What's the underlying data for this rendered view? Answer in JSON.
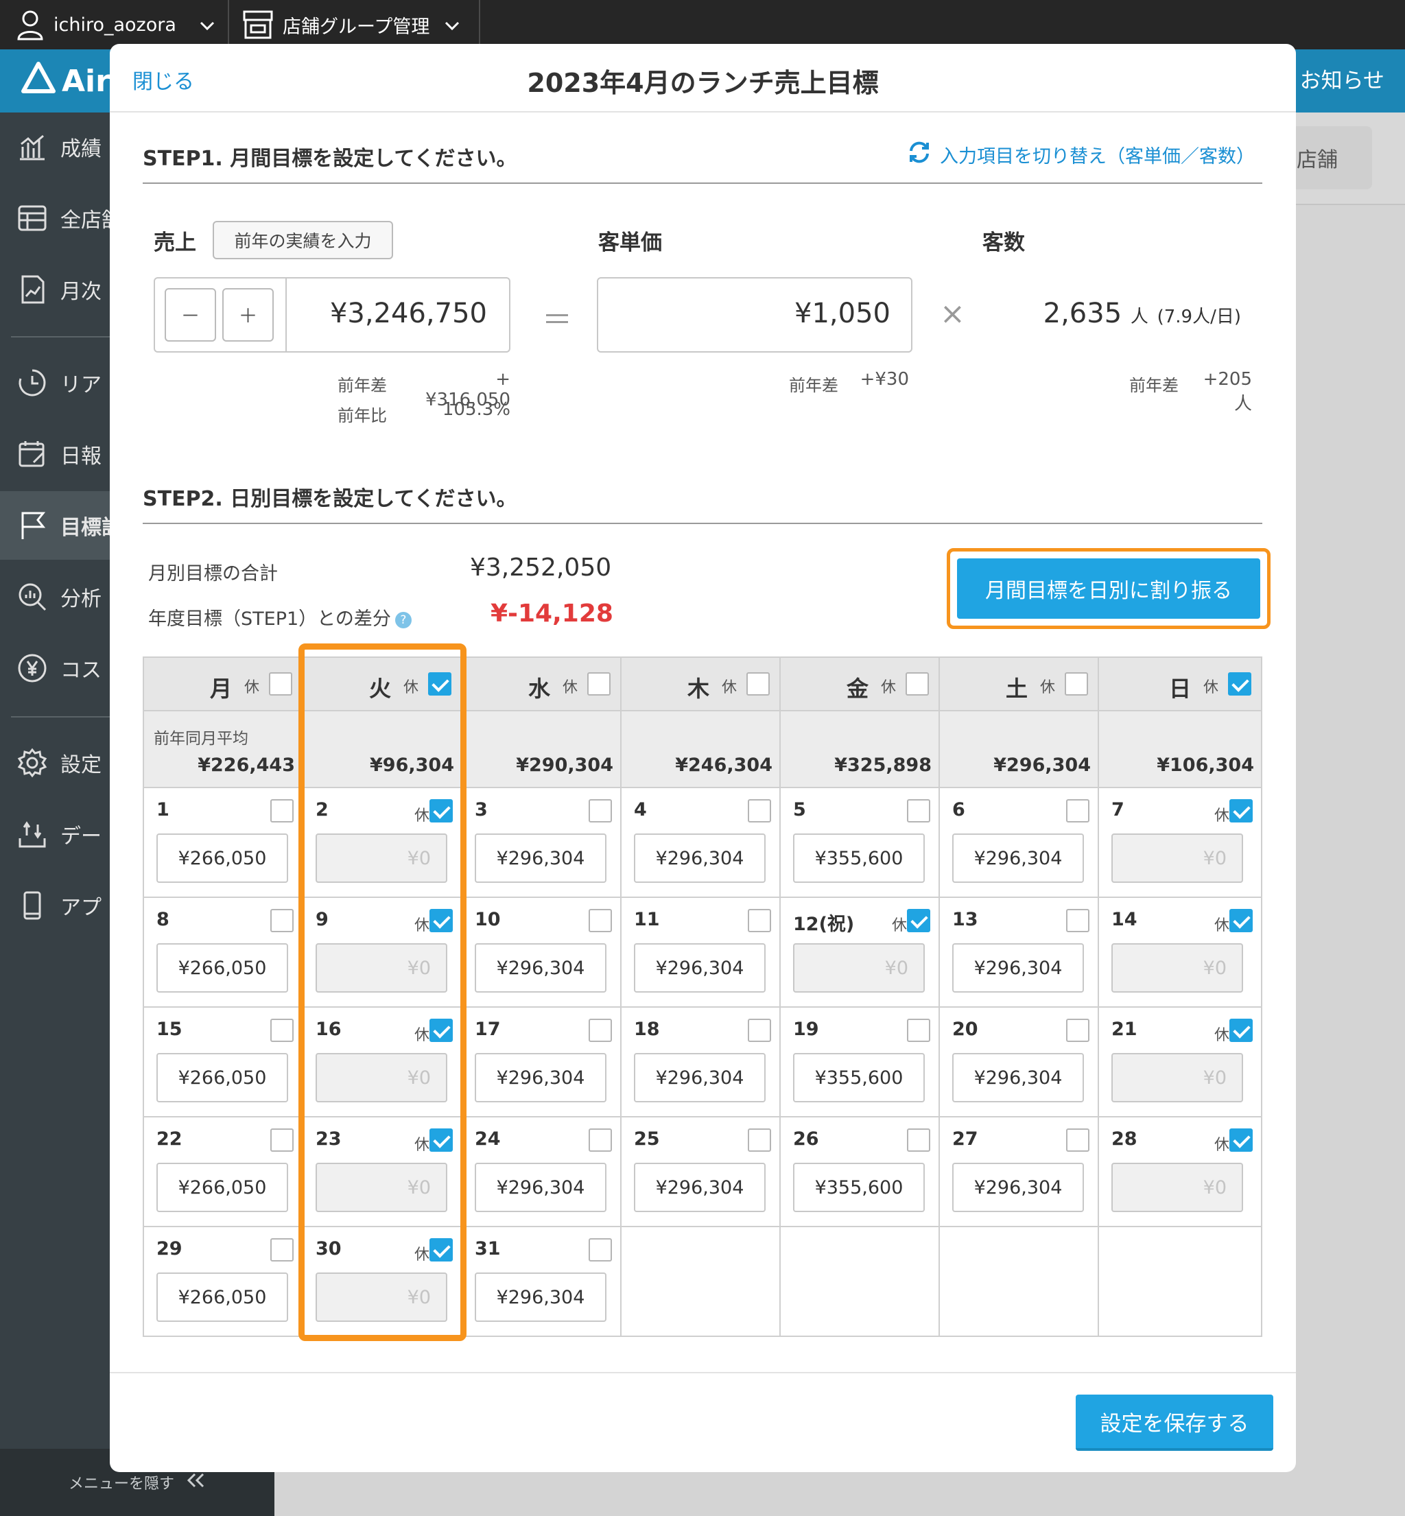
{
  "topbar": {
    "user": "ichiro_aozora",
    "store_menu": "店舗グループ管理",
    "notice": "お知らせ"
  },
  "brand": {
    "name": "Air"
  },
  "sidebar": {
    "items": [
      {
        "label": "成績",
        "icon": "bar-chart-icon"
      },
      {
        "label": "全店舗",
        "icon": "table-icon"
      },
      {
        "label": "月次",
        "icon": "report-icon"
      },
      {
        "label": "リア",
        "icon": "clock-icon"
      },
      {
        "label": "日報",
        "icon": "calendar-edit-icon"
      },
      {
        "label": "目標設",
        "icon": "flag-icon",
        "active": true
      },
      {
        "label": "分析",
        "icon": "analysis-icon"
      },
      {
        "label": "コス",
        "icon": "yen-icon"
      },
      {
        "label": "設定",
        "icon": "gear-icon"
      },
      {
        "label": "デー",
        "icon": "data-icon"
      },
      {
        "label": "アプ",
        "icon": "phone-icon"
      }
    ],
    "hide_menu": "メニューを隠す"
  },
  "background": {
    "tab": "店舗"
  },
  "modal": {
    "close": "閉じる",
    "title": "2023年4月のランチ売上目標",
    "step1": {
      "title": "STEP1. 月間目標を設定してください。",
      "switch_label": "入力項目を切り替え（客単価／客数）",
      "sales_label": "売上",
      "prev_button": "前年の実績を入力",
      "minus": "－",
      "plus": "＋",
      "sales_value": "¥3,246,750",
      "equals": "＝",
      "price_label": "客単価",
      "price_value": "¥1,050",
      "times": "×",
      "customers_label": "客数",
      "customers_value": "2,635",
      "customers_unit": "人",
      "customers_per_day": "(7.9人/日)",
      "sales_diff_label": "前年差",
      "sales_diff": "+¥316,050",
      "sales_ratio_label": "前年比",
      "sales_ratio": "105.3%",
      "price_diff_label": "前年差",
      "price_diff": "+¥30",
      "cust_diff_label": "前年差",
      "cust_diff": "+205人"
    },
    "step2": {
      "title": "STEP2. 日別目標を設定してください。",
      "total_label": "月別目標の合計",
      "total_value": "¥3,252,050",
      "gap_label": "年度目標（STEP1）との差分",
      "help": "?",
      "gap_value": "¥-14,128",
      "allocate_button": "月間目標を日別に割り振る",
      "holiday_label": "休",
      "avg_label": "前年同月平均",
      "weekdays": [
        {
          "name": "月",
          "closed": false,
          "avg": "¥226,443"
        },
        {
          "name": "火",
          "closed": true,
          "avg": "¥96,304"
        },
        {
          "name": "水",
          "closed": false,
          "avg": "¥290,304"
        },
        {
          "name": "木",
          "closed": false,
          "avg": "¥246,304"
        },
        {
          "name": "金",
          "closed": false,
          "avg": "¥325,898"
        },
        {
          "name": "土",
          "closed": false,
          "avg": "¥296,304"
        },
        {
          "name": "日",
          "closed": true,
          "avg": "¥106,304"
        }
      ],
      "weeks": [
        [
          {
            "day": "1",
            "closed": false,
            "value": "¥266,050"
          },
          {
            "day": "2",
            "closed": true,
            "value": "¥0"
          },
          {
            "day": "3",
            "closed": false,
            "value": "¥296,304"
          },
          {
            "day": "4",
            "closed": false,
            "value": "¥296,304"
          },
          {
            "day": "5",
            "closed": false,
            "value": "¥355,600"
          },
          {
            "day": "6",
            "closed": false,
            "value": "¥296,304"
          },
          {
            "day": "7",
            "closed": true,
            "value": "¥0"
          }
        ],
        [
          {
            "day": "8",
            "closed": false,
            "value": "¥266,050"
          },
          {
            "day": "9",
            "closed": true,
            "value": "¥0"
          },
          {
            "day": "10",
            "closed": false,
            "value": "¥296,304"
          },
          {
            "day": "11",
            "closed": false,
            "value": "¥296,304"
          },
          {
            "day": "12(祝)",
            "closed": true,
            "value": "¥0"
          },
          {
            "day": "13",
            "closed": false,
            "value": "¥296,304"
          },
          {
            "day": "14",
            "closed": true,
            "value": "¥0"
          }
        ],
        [
          {
            "day": "15",
            "closed": false,
            "value": "¥266,050"
          },
          {
            "day": "16",
            "closed": true,
            "value": "¥0"
          },
          {
            "day": "17",
            "closed": false,
            "value": "¥296,304"
          },
          {
            "day": "18",
            "closed": false,
            "value": "¥296,304"
          },
          {
            "day": "19",
            "closed": false,
            "value": "¥355,600"
          },
          {
            "day": "20",
            "closed": false,
            "value": "¥296,304"
          },
          {
            "day": "21",
            "closed": true,
            "value": "¥0"
          }
        ],
        [
          {
            "day": "22",
            "closed": false,
            "value": "¥266,050"
          },
          {
            "day": "23",
            "closed": true,
            "value": "¥0"
          },
          {
            "day": "24",
            "closed": false,
            "value": "¥296,304"
          },
          {
            "day": "25",
            "closed": false,
            "value": "¥296,304"
          },
          {
            "day": "26",
            "closed": false,
            "value": "¥355,600"
          },
          {
            "day": "27",
            "closed": false,
            "value": "¥296,304"
          },
          {
            "day": "28",
            "closed": true,
            "value": "¥0"
          }
        ],
        [
          {
            "day": "29",
            "closed": false,
            "value": "¥266,050"
          },
          {
            "day": "30",
            "closed": true,
            "value": "¥0"
          },
          {
            "day": "31",
            "closed": false,
            "value": "¥296,304"
          },
          null,
          null,
          null,
          null
        ]
      ]
    },
    "save_button": "設定を保存する"
  },
  "colors": {
    "accent": "#20a4e2",
    "highlight": "#f7941d",
    "negative": "#e23b3b",
    "link": "#1a8fd3",
    "sidebar": "#374045",
    "brand_bar": "#1c86b5"
  }
}
